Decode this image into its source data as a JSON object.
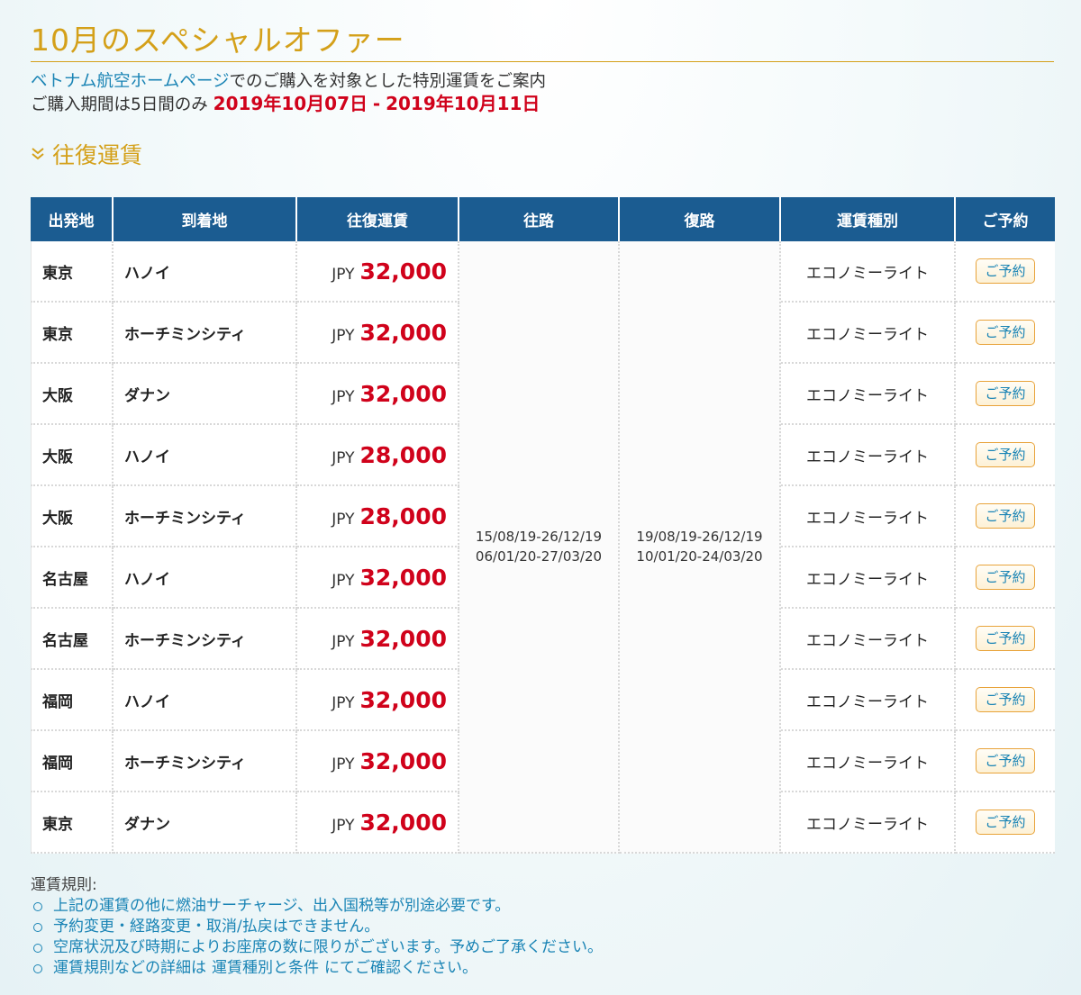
{
  "header": {
    "title": "10月のスペシャルオファー",
    "intro_link": "ベトナム航空ホームページ",
    "intro_rest": "でのご購入を対象とした特別運賃をご案内",
    "period_label": "ご購入期間は5日間のみ",
    "period_start": "2019年10月07日",
    "period_sep": "-",
    "period_end": "2019年10月11日"
  },
  "section": {
    "title": "往復運賃",
    "icon": "double-chevron-down-icon"
  },
  "table": {
    "columns": [
      "出発地",
      "到着地",
      "往復運賃",
      "往路",
      "復路",
      "運賃種別",
      "ご予約"
    ],
    "outbound": [
      "15/08/19-26/12/19",
      "06/01/20-27/03/20"
    ],
    "inbound": [
      "19/08/19-26/12/19",
      "10/01/20-24/03/20"
    ],
    "rows": [
      {
        "from": "東京",
        "to": "ハノイ",
        "currency": "JPY",
        "price": "32,000",
        "fare_type": "エコノミーライト",
        "book": "ご予約"
      },
      {
        "from": "東京",
        "to": "ホーチミンシティ",
        "currency": "JPY",
        "price": "32,000",
        "fare_type": "エコノミーライト",
        "book": "ご予約"
      },
      {
        "from": "大阪",
        "to": "ダナン",
        "currency": "JPY",
        "price": "32,000",
        "fare_type": "エコノミーライト",
        "book": "ご予約"
      },
      {
        "from": "大阪",
        "to": "ハノイ",
        "currency": "JPY",
        "price": "28,000",
        "fare_type": "エコノミーライト",
        "book": "ご予約"
      },
      {
        "from": "大阪",
        "to": "ホーチミンシティ",
        "currency": "JPY",
        "price": "28,000",
        "fare_type": "エコノミーライト",
        "book": "ご予約"
      },
      {
        "from": "名古屋",
        "to": "ハノイ",
        "currency": "JPY",
        "price": "32,000",
        "fare_type": "エコノミーライト",
        "book": "ご予約"
      },
      {
        "from": "名古屋",
        "to": "ホーチミンシティ",
        "currency": "JPY",
        "price": "32,000",
        "fare_type": "エコノミーライト",
        "book": "ご予約"
      },
      {
        "from": "福岡",
        "to": "ハノイ",
        "currency": "JPY",
        "price": "32,000",
        "fare_type": "エコノミーライト",
        "book": "ご予約"
      },
      {
        "from": "福岡",
        "to": "ホーチミンシティ",
        "currency": "JPY",
        "price": "32,000",
        "fare_type": "エコノミーライト",
        "book": "ご予約"
      },
      {
        "from": "東京",
        "to": "ダナン",
        "currency": "JPY",
        "price": "32,000",
        "fare_type": "エコノミーライト",
        "book": "ご予約"
      }
    ]
  },
  "rules": {
    "title": "運賃規則:",
    "items": [
      "上記の運賃の他に燃油サーチャージ、出入国税等が別途必要です。",
      "予約変更・経路変更・取消/払戻はできません。",
      "空席状況及び時期によりお座席の数に限りがございます。予めご了承ください。"
    ],
    "last_item_prefix": "運賃規則などの詳細は",
    "last_item_link": "運賃種別と条件",
    "last_item_suffix": "にてご確認ください。"
  },
  "colors": {
    "accent": "#d4a019",
    "header_bg": "#1b5c91",
    "price": "#d0021b",
    "link": "#1a84b5"
  }
}
